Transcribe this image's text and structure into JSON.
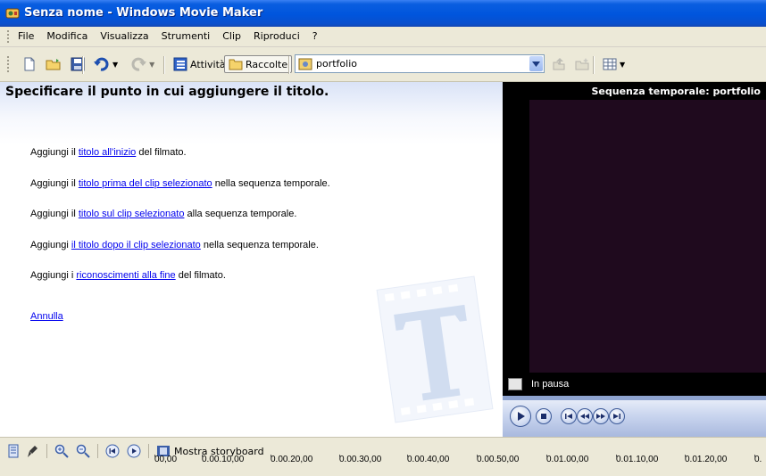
{
  "window": {
    "title": "Senza nome - Windows Movie Maker"
  },
  "menu": [
    "File",
    "Modifica",
    "Visualizza",
    "Strumenti",
    "Clip",
    "Riproduci",
    "?"
  ],
  "toolbar": {
    "activities_label": "Attività",
    "collections_label": "Raccolte",
    "collection_value": "portfolio"
  },
  "task": {
    "heading": "Specificare il punto in cui aggiungere il titolo.",
    "lines": [
      {
        "pre": "Aggiungi il ",
        "link": "titolo all'inizio",
        "post": " del filmato."
      },
      {
        "pre": "Aggiungi il ",
        "link": "titolo prima del clip selezionato",
        "post": " nella sequenza temporale."
      },
      {
        "pre": "Aggiungi il ",
        "link": "titolo sul clip selezionato",
        "post": " alla sequenza temporale."
      },
      {
        "pre": "Aggiungi ",
        "link": "il titolo dopo il clip selezionato",
        "post": " nella sequenza temporale."
      },
      {
        "pre": "Aggiungi i ",
        "link": "riconoscimenti alla fine",
        "post": " del filmato."
      }
    ],
    "cancel": "Annulla"
  },
  "monitor": {
    "title": "Sequenza temporale: portfolio",
    "status": "In pausa"
  },
  "timeline": {
    "storyboard_label": "Mostra storyboard",
    "ticks": [
      "00,00",
      "0.00.10,00",
      "0.00.20,00",
      "0.00.30,00",
      "0.00.40,00",
      "0.00.50,00",
      "0.01.00,00",
      "0.01.10,00",
      "0.01.20,00",
      "0."
    ]
  },
  "colors": {
    "titlebar": "#0055dd",
    "chrome": "#ece9d8",
    "link": "#0000ee",
    "monitor_bg": "#000000"
  }
}
